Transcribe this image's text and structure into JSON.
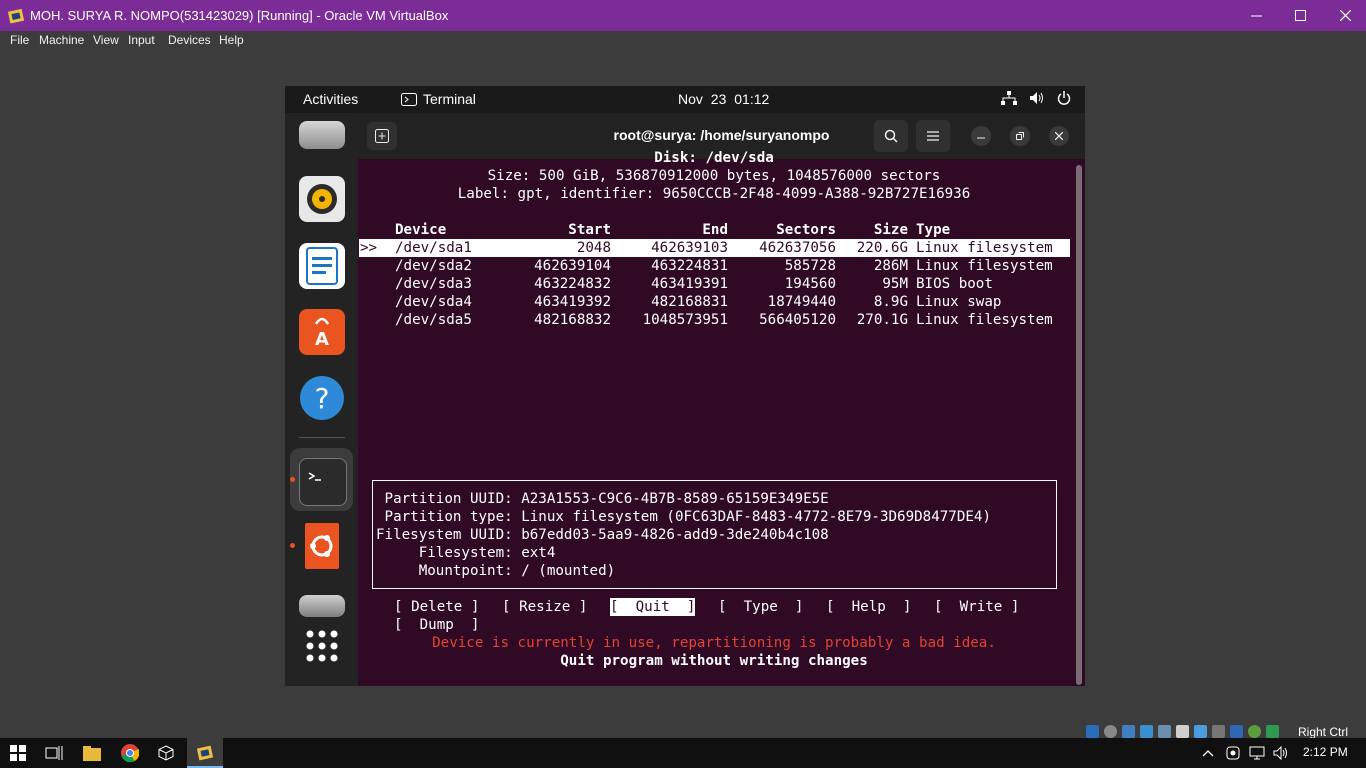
{
  "window": {
    "title": "MOH. SURYA R. NOMPO(531423029) [Running] - Oracle VM VirtualBox",
    "menu": [
      "File",
      "Machine",
      "View",
      "Input",
      "Devices",
      "Help"
    ]
  },
  "gnome": {
    "activities": "Activities",
    "app_name": "Terminal",
    "clock": "Nov 23  01:12"
  },
  "terminal": {
    "title": "root@surya: /home/suryanompo"
  },
  "cfdisk": {
    "disk": "Disk: /dev/sda",
    "size_line": "Size: 500 GiB, 536870912000 bytes, 1048576000 sectors",
    "label_line": "Label: gpt, identifier: 9650CCCB-2F48-4099-A388-92B727E16936",
    "headers": {
      "device": "Device",
      "start": "Start",
      "end": "End",
      "sectors": "Sectors",
      "size": "Size",
      "type": "Type"
    },
    "cursor": ">>",
    "partitions": [
      {
        "device": "/dev/sda1",
        "start": "2048",
        "end": "462639103",
        "sectors": "462637056",
        "size": "220.6G",
        "type": "Linux filesystem"
      },
      {
        "device": "/dev/sda2",
        "start": "462639104",
        "end": "463224831",
        "sectors": "585728",
        "size": "286M",
        "type": "Linux filesystem"
      },
      {
        "device": "/dev/sda3",
        "start": "463224832",
        "end": "463419391",
        "sectors": "194560",
        "size": "95M",
        "type": "BIOS boot"
      },
      {
        "device": "/dev/sda4",
        "start": "463419392",
        "end": "482168831",
        "sectors": "18749440",
        "size": "8.9G",
        "type": "Linux swap"
      },
      {
        "device": "/dev/sda5",
        "start": "482168832",
        "end": "1048573951",
        "sectors": "566405120",
        "size": "270.1G",
        "type": "Linux filesystem"
      }
    ],
    "info": [
      " Partition UUID: A23A1553-C9C6-4B7B-8589-65159E349E5E",
      " Partition type: Linux filesystem (0FC63DAF-8483-4772-8E79-3D69D8477DE4)",
      "Filesystem UUID: b67edd03-5aa9-4826-add9-3de240b4c108",
      "     Filesystem: ext4",
      "     Mountpoint: / (mounted)"
    ],
    "buttons": {
      "delete": "[ Delete ]",
      "resize": "[ Resize ]",
      "quit": "[  Quit  ]",
      "type": "[  Type  ]",
      "help": "[  Help  ]",
      "write": "[  Write ]",
      "dump": "[  Dump  ]"
    },
    "warning": "Device is currently in use, repartitioning is probably a bad idea.",
    "hint": "Quit program without writing changes"
  },
  "host": {
    "right_ctrl": "Right Ctrl",
    "time": "2:12 PM"
  }
}
